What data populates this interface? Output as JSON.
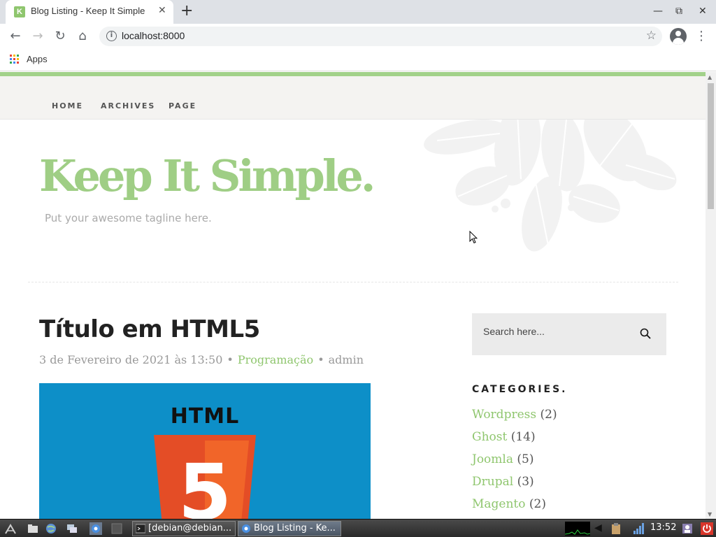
{
  "browser": {
    "tab_title": "Blog Listing - Keep It Simple",
    "favicon_letter": "K",
    "url": "localhost:8000",
    "bookmarks_apps_label": "Apps"
  },
  "site": {
    "nav": [
      "HOME",
      "ARCHIVES",
      "PAGE"
    ],
    "title": "Keep It Simple.",
    "tagline": "Put your awesome tagline here."
  },
  "post": {
    "title": "Título em HTML5",
    "date": "3 de Fevereiro de 2021 às 13:50",
    "category": "Programação",
    "author": "admin",
    "image_text": "HTML",
    "image_shield_number": "5"
  },
  "sidebar": {
    "search_placeholder": "Search here...",
    "categories_heading": "CATEGORIES.",
    "categories": [
      {
        "name": "Wordpress",
        "count": "(2)"
      },
      {
        "name": "Ghost",
        "count": "(14)"
      },
      {
        "name": "Joomla",
        "count": "(5)"
      },
      {
        "name": "Drupal",
        "count": "(3)"
      },
      {
        "name": "Magento",
        "count": "(2)"
      }
    ]
  },
  "taskbar": {
    "tasks": [
      "[debian@debian...",
      "Blog Listing - Ke..."
    ],
    "clock": "13:52"
  },
  "colors": {
    "accent_green": "#9fce85",
    "link_green": "#8fc66e",
    "html5_orange": "#e44d26",
    "image_blue": "#0d8fc8"
  }
}
